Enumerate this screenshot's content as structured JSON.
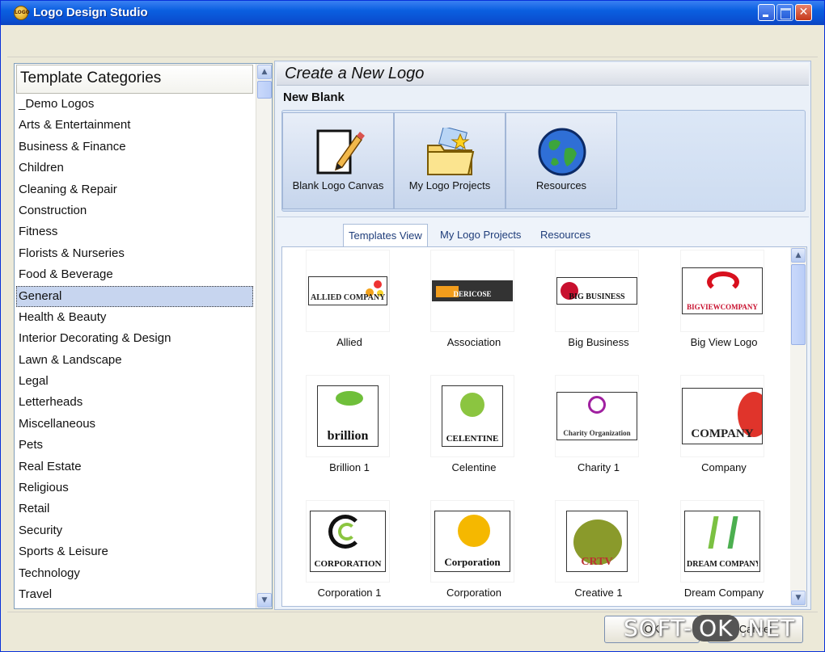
{
  "window": {
    "title": "Logo Design Studio",
    "icon": "app-logo-icon"
  },
  "left": {
    "header": "Template Categories",
    "selected": "General",
    "categories": [
      "_Demo Logos",
      "Arts & Entertainment",
      "Business & Finance",
      "Children",
      "Cleaning & Repair",
      "Construction",
      "Fitness",
      "Florists & Nurseries",
      "Food & Beverage",
      "General",
      "Health & Beauty",
      "Interior Decorating & Design",
      "Lawn & Landscape",
      "Legal",
      "Letterheads",
      "Miscellaneous",
      "Pets",
      "Real Estate",
      "Religious",
      "Retail",
      "Security",
      "Sports & Leisure",
      "Technology",
      "Travel"
    ]
  },
  "right": {
    "title": "Create a New Logo",
    "new_blank_label": "New Blank",
    "blank_buttons": [
      {
        "label": "Blank Logo Canvas",
        "icon": "blank-canvas-icon"
      },
      {
        "label": "My Logo Projects",
        "icon": "folder-icon"
      },
      {
        "label": "Resources",
        "icon": "globe-icon"
      }
    ],
    "tabs": [
      "Templates View",
      "My Logo Projects",
      "Resources"
    ],
    "active_tab": "Templates View",
    "templates": [
      {
        "name": "Allied",
        "logo_text": "ALLIED COMPANY"
      },
      {
        "name": "Association",
        "logo_text": "DERICOSE"
      },
      {
        "name": "Big Business",
        "logo_text": "BIG BUSINESS"
      },
      {
        "name": "Big View Logo",
        "logo_text": "BIGVIEWCOMPANY"
      },
      {
        "name": "Brillion 1",
        "logo_text": "brillion"
      },
      {
        "name": "Celentine",
        "logo_text": "CELENTINE"
      },
      {
        "name": "Charity 1",
        "logo_text": "Charity Organization"
      },
      {
        "name": "Company",
        "logo_text": "COMPANY"
      },
      {
        "name": "Corporation 1",
        "logo_text": "CORPORATION"
      },
      {
        "name": "Corporation",
        "logo_text": "Corporation"
      },
      {
        "name": "Creative 1",
        "logo_text": "CRTV"
      },
      {
        "name": "Dream Company",
        "logo_text": "DREAM COMPANY"
      }
    ]
  },
  "footer": {
    "ok_label": "OK",
    "cancel_label": "Cancel"
  },
  "watermark": {
    "left": "SOFT-",
    "ok": "OK",
    "right": ".NET"
  }
}
